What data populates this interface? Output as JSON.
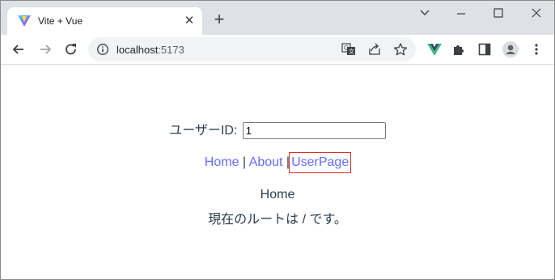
{
  "browser": {
    "tab_title": "Vite + Vue",
    "tab_close": "✕",
    "new_tab": "+",
    "url_host": "localhost",
    "url_port": ":5173"
  },
  "page": {
    "userid_label": "ユーザーID:",
    "userid_value": "1",
    "nav": {
      "home": "Home",
      "about": "About",
      "userpage": "UserPage",
      "separator": "|"
    },
    "home_title": "Home",
    "route_text": "現在のルートは / です。"
  },
  "colors": {
    "link": "#646cff",
    "text": "#2c3e50",
    "active_outline": "#d93025",
    "tabstrip": "#dee1e6"
  }
}
